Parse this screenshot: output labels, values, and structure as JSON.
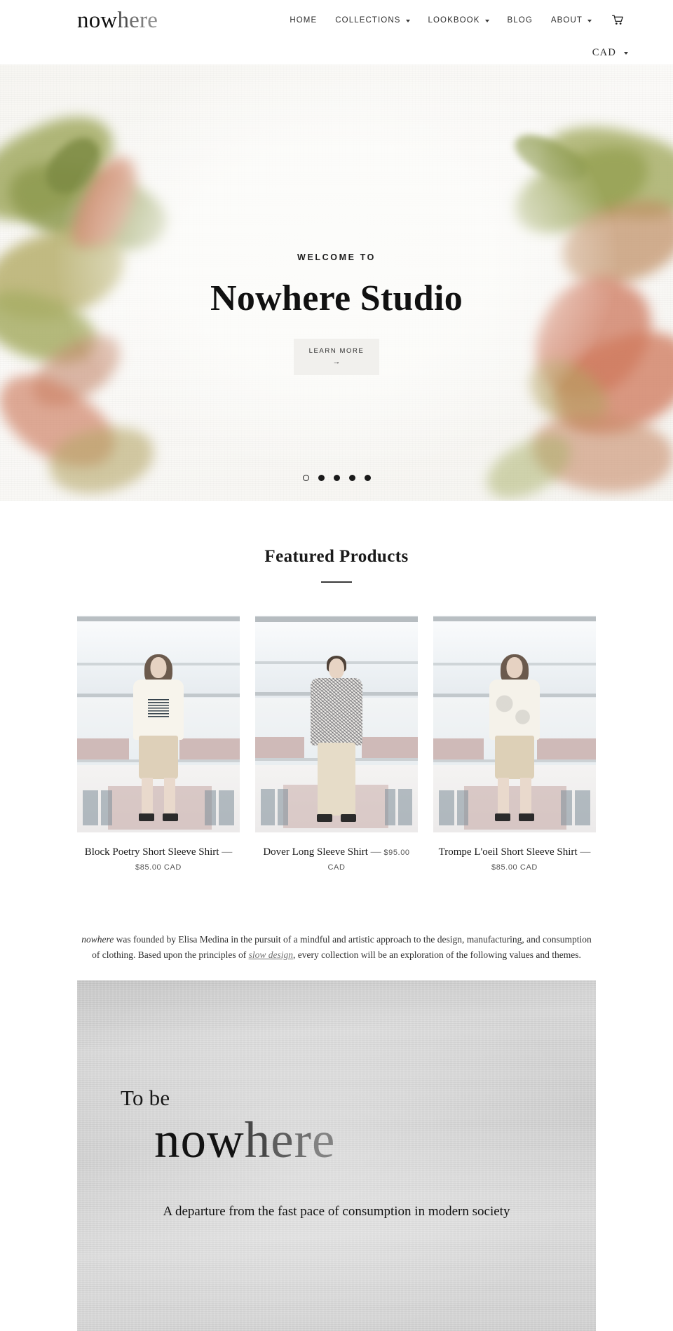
{
  "header": {
    "logo": {
      "part_dark": "now",
      "part_h": "h",
      "part_e1": "e",
      "part_r": "r",
      "part_e2": "e",
      "full": "nowhere"
    },
    "nav": [
      {
        "label": "HOME",
        "has_dropdown": false
      },
      {
        "label": "COLLECTIONS",
        "has_dropdown": true
      },
      {
        "label": "LOOKBOOK",
        "has_dropdown": true
      },
      {
        "label": "BLOG",
        "has_dropdown": false
      },
      {
        "label": "ABOUT",
        "has_dropdown": true
      }
    ],
    "cart_icon": "shopping-cart-icon",
    "currency": {
      "value": "CAD",
      "caret": "chevron-down-icon"
    }
  },
  "hero": {
    "kicker": "WELCOME TO",
    "title": "Nowhere Studio",
    "button": {
      "label": "LEARN MORE",
      "arrow": "→"
    },
    "slides": {
      "count": 5,
      "active_index": 0
    }
  },
  "featured": {
    "title": "Featured Products",
    "products": [
      {
        "name": "Block Poetry Short Sleeve Shirt",
        "dash": "—",
        "price": "$85.00 CAD"
      },
      {
        "name": "Dover Long Sleeve Shirt",
        "dash": "—",
        "price": "$95.00 CAD"
      },
      {
        "name": "Trompe L'oeil Short Sleeve Shirt",
        "dash": "—",
        "price": "$85.00 CAD"
      }
    ]
  },
  "about": {
    "brand_italic": "nowhere",
    "text_1": " was founded by Elisa Medina in the pursuit of a mindful and artistic approach to the design, manufacturing, and consumption of clothing. Based upon the principles of ",
    "link": "slow design",
    "text_2": ", every collection will be an exploration of the following values and themes."
  },
  "panel": {
    "to_be": "To be",
    "word": {
      "part_dark": "now",
      "part_h": "h",
      "part_e1": "e",
      "part_r": "r",
      "part_e2": "e",
      "full": "nowhere"
    },
    "caption": "A departure from the fast pace of consumption in modern society"
  },
  "colors": {
    "ink": "#111111",
    "muted": "#707070",
    "panel_bg": "#d3d3d3",
    "hero_btn_bg": "#f0efec",
    "leaf_green": "#9aa45c",
    "leaf_rust": "#cb7a62"
  }
}
